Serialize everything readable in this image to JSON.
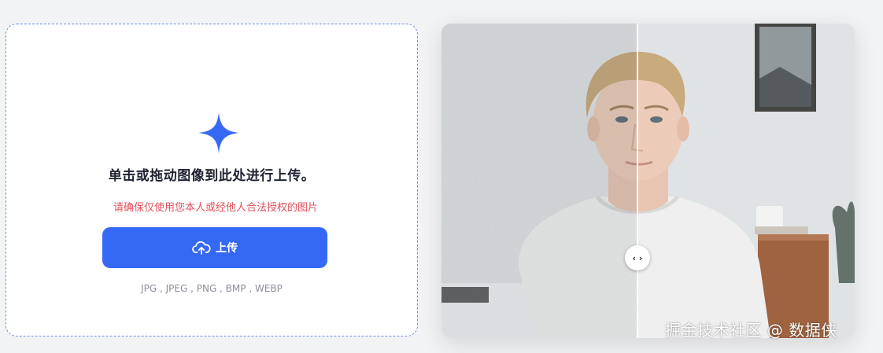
{
  "upload": {
    "headline": "单击或拖动图像到此处进行上传。",
    "notice": "请确保仅使用您本人或经他人合法授权的图片",
    "button_label": "上传",
    "formats": "JPG , JPEG , PNG , BMP , WEBP"
  },
  "compare": {
    "handle_glyph": "‹ ›"
  },
  "watermark": "掘金技术社区 @ 数据侠",
  "colors": {
    "accent": "#3568f5",
    "notice": "#e0505c",
    "headline": "#1d2330"
  },
  "icons": [
    "sparkle-icon",
    "cloud-upload-icon",
    "compare-arrows-icon"
  ]
}
